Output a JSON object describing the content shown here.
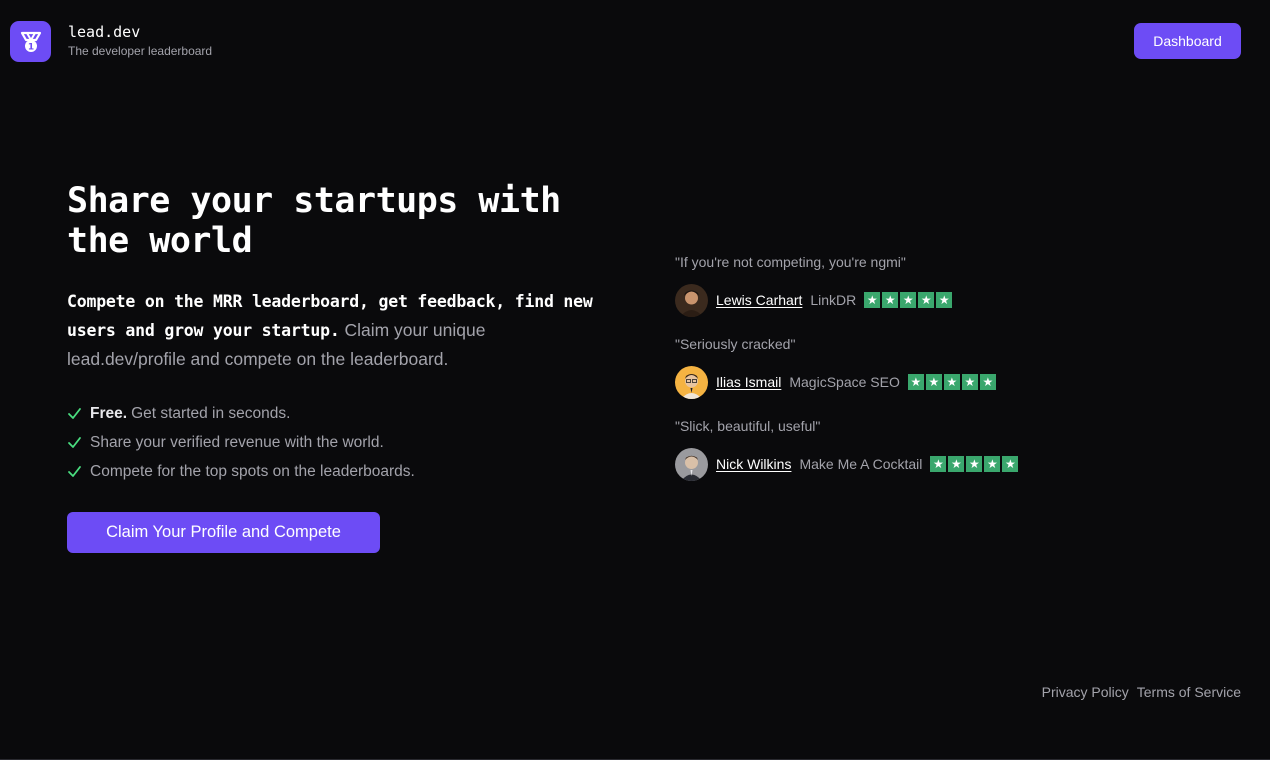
{
  "header": {
    "brand_name": "lead.dev",
    "tagline": "The developer leaderboard",
    "dashboard_label": "Dashboard",
    "logo_icon": "medal-icon"
  },
  "hero": {
    "title": "Share your startups with the world",
    "subtitle_strong": "Compete on the MRR leaderboard, get feedback, find new users and grow your startup.",
    "subtitle_rest": "Claim your unique lead.dev/profile and compete on the leaderboard.",
    "features": [
      {
        "bold": "Free.",
        "text": "Get started in seconds."
      },
      {
        "bold": "",
        "text": "Share your verified revenue with the world."
      },
      {
        "bold": "",
        "text": "Compete for the top spots on the leaderboards."
      }
    ],
    "cta_label": "Claim Your Profile and Compete"
  },
  "testimonials": [
    {
      "quote": "\"If you're not competing, you're ngmi\"",
      "name": "Lewis Carhart",
      "company": "LinkDR",
      "rating": 5
    },
    {
      "quote": "\"Seriously cracked\"",
      "name": "Ilias Ismail",
      "company": "MagicSpace SEO",
      "rating": 5
    },
    {
      "quote": "\"Slick, beautiful, useful\"",
      "name": "Nick Wilkins",
      "company": "Make Me A Cocktail",
      "rating": 5
    }
  ],
  "footer": {
    "privacy": "Privacy Policy",
    "terms": "Terms of Service"
  },
  "colors": {
    "background": "#0a0a0c",
    "accent": "#6d4cf5",
    "star_green": "#3aa76d",
    "check_green": "#4ade80",
    "muted_text": "#a3a3ab"
  }
}
